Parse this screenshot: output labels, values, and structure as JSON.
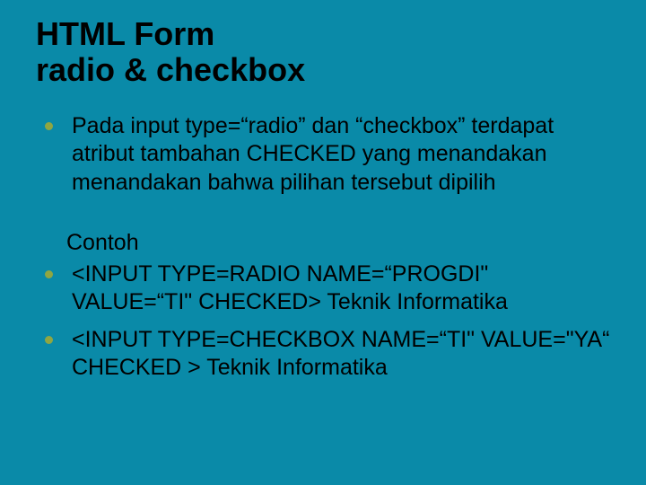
{
  "title_line1": "HTML Form",
  "title_line2": "radio & checkbox",
  "bullets_top": [
    "Pada input type=“radio” dan “checkbox” terdapat atribut tambahan CHECKED yang menandakan menandakan bahwa pilihan tersebut dipilih"
  ],
  "subhead": "Contoh",
  "bullets_bottom": [
    "<INPUT TYPE=RADIO NAME=“PROGDI\" VALUE=“TI\" CHECKED> Teknik Informatika",
    "<INPUT TYPE=CHECKBOX NAME=“TI\" VALUE=\"YA“ CHECKED > Teknik Informatika"
  ]
}
